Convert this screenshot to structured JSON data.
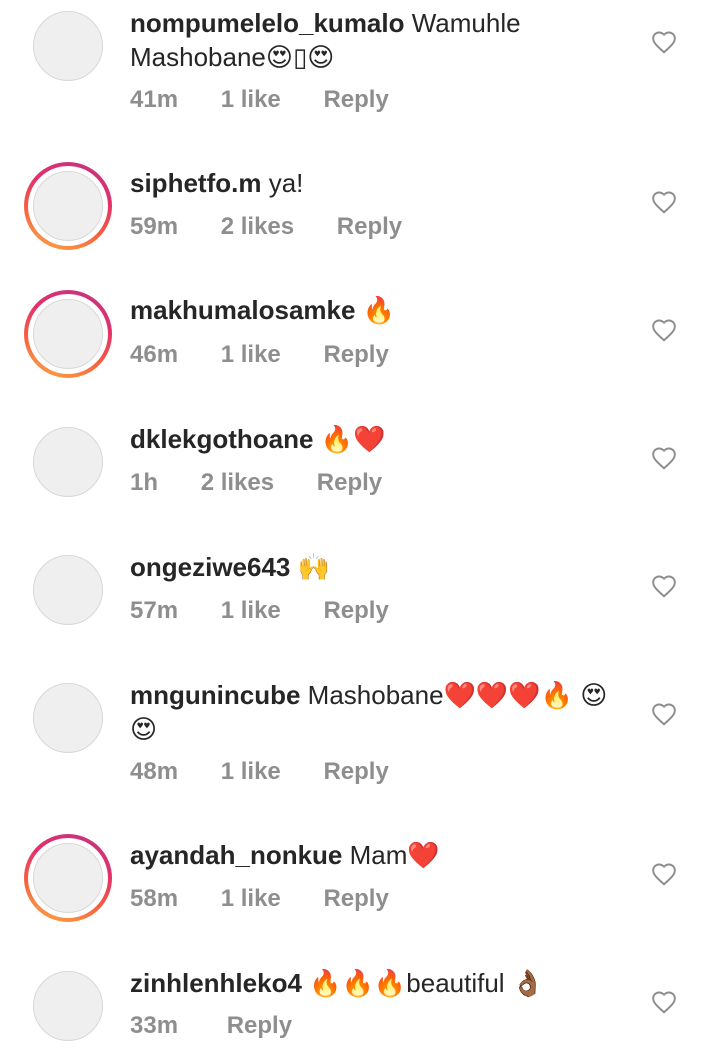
{
  "comments": [
    {
      "username": "nompumelelo_kumalo",
      "text": "Wamuhle Mashobane😍▯😍",
      "time": "41m",
      "likes": "1 like",
      "reply": "Reply",
      "story": false
    },
    {
      "username": "siphetfo.m",
      "text": "ya!",
      "time": "59m",
      "likes": "2 likes",
      "reply": "Reply",
      "story": true
    },
    {
      "username": "makhumalosamke",
      "text": "🔥",
      "time": "46m",
      "likes": "1 like",
      "reply": "Reply",
      "story": true
    },
    {
      "username": "dklekgothoane",
      "text": "🔥❤️",
      "time": "1h",
      "likes": "2 likes",
      "reply": "Reply",
      "story": false
    },
    {
      "username": "ongeziwe643",
      "text": "🙌",
      "time": "57m",
      "likes": "1 like",
      "reply": "Reply",
      "story": false
    },
    {
      "username": "mngunincube",
      "text": "Mashobane❤️❤️❤️🔥 😍😍",
      "time": "48m",
      "likes": "1 like",
      "reply": "Reply",
      "story": false
    },
    {
      "username": "ayandah_nonkue",
      "text": "Mam❤️",
      "time": "58m",
      "likes": "1 like",
      "reply": "Reply",
      "story": true
    },
    {
      "username": "zinhlenhleko4",
      "text": "🔥🔥🔥beautiful 👌🏾",
      "time": "33m",
      "likes": "",
      "reply": "Reply",
      "story": false
    }
  ],
  "icons": {
    "like": "heart-outline-icon",
    "avatar": "profile-avatar-placeholder"
  },
  "colors": {
    "username": "#262626",
    "meta": "#8e8e8e",
    "story_ring_start": "#c13584",
    "story_ring_end": "#fcaf45"
  }
}
